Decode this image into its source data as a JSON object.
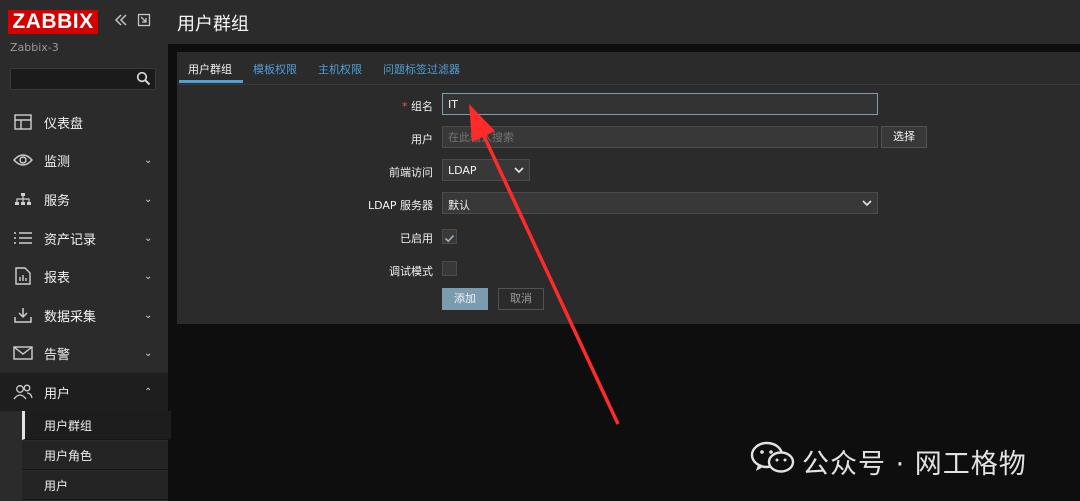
{
  "brand": {
    "logo_text": "ZABBIX",
    "server_name": "Zabbix-3",
    "accent": "#d40000"
  },
  "sidebar": {
    "search": {
      "value": "",
      "placeholder": ""
    },
    "items": [
      {
        "label": "仪表盘",
        "icon": "dashboard-icon"
      },
      {
        "label": "监测",
        "icon": "eye-icon"
      },
      {
        "label": "服务",
        "icon": "services-icon"
      },
      {
        "label": "资产记录",
        "icon": "list-icon"
      },
      {
        "label": "报表",
        "icon": "report-icon"
      },
      {
        "label": "数据采集",
        "icon": "download-icon"
      },
      {
        "label": "告警",
        "icon": "mail-icon"
      },
      {
        "label": "用户",
        "icon": "users-icon"
      }
    ],
    "subitems": [
      "用户群组",
      "用户角色",
      "用户"
    ]
  },
  "header": {
    "title": "用户群组"
  },
  "tabs": [
    "用户群组",
    "模板权限",
    "主机权限",
    "问题标签过滤器"
  ],
  "form": {
    "group_name": {
      "required_mark": "*",
      "label": "组名",
      "value": "IT"
    },
    "users": {
      "label": "用户",
      "placeholder": "在此输入搜索",
      "select_button": "选择"
    },
    "frontend_access": {
      "label": "前端访问",
      "value": "LDAP"
    },
    "ldap_server": {
      "label": "LDAP 服务器",
      "value": "默认"
    },
    "enabled": {
      "label": "已启用",
      "checked": true
    },
    "debug_mode": {
      "label": "调试模式",
      "checked": false
    },
    "add_button": "添加",
    "cancel_button": "取消"
  },
  "watermark": {
    "text": "公众号 · 网工格物"
  }
}
